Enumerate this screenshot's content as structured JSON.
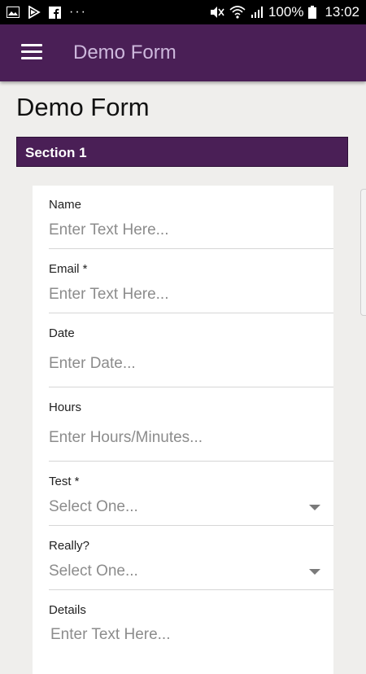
{
  "status_bar": {
    "left_icons": [
      "image-icon",
      "play-store-icon",
      "facebook-icon",
      "more-dots-icon"
    ],
    "dots": "···",
    "battery": "100%",
    "time": "13:02"
  },
  "app_bar": {
    "title": "Demo Form"
  },
  "page": {
    "title": "Demo Form"
  },
  "section": {
    "title": "Section 1"
  },
  "form": {
    "fields": [
      {
        "label": "Name",
        "placeholder": "Enter Text Here..."
      },
      {
        "label": "Email *",
        "placeholder": "Enter Text Here..."
      },
      {
        "label": "Date",
        "placeholder": "Enter Date..."
      },
      {
        "label": "Hours",
        "placeholder": "Enter Hours/Minutes..."
      },
      {
        "label": "Test *",
        "placeholder": "Select One...",
        "type": "select"
      },
      {
        "label": "Really?",
        "placeholder": "Select One...",
        "type": "select"
      },
      {
        "label": "Details",
        "placeholder": "Enter Text Here..."
      }
    ]
  },
  "colors": {
    "primary": "#4a1f56",
    "app_bar_title": "#cdb8dc",
    "background": "#efeeec"
  }
}
